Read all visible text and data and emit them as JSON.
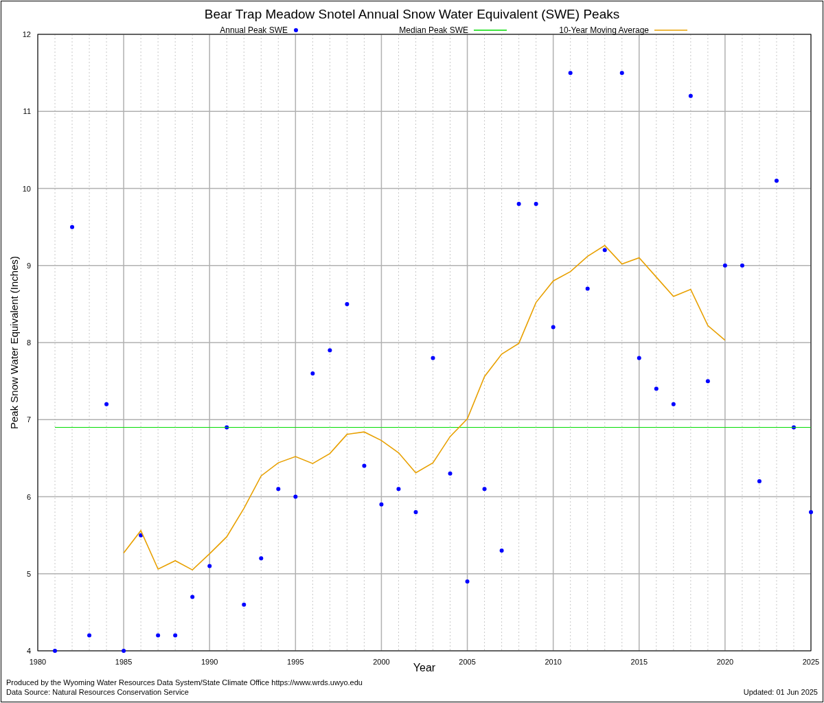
{
  "chart_data": {
    "type": "scatter",
    "title": "Bear Trap Meadow Snotel Annual Snow Water Equivalent (SWE) Peaks",
    "xlabel": "Year",
    "ylabel": "Peak Snow Water Equivalent (Inches)",
    "x": [
      1981,
      1982,
      1983,
      1984,
      1985,
      1986,
      1987,
      1988,
      1989,
      1990,
      1991,
      1992,
      1993,
      1994,
      1995,
      1996,
      1997,
      1998,
      1999,
      2000,
      2001,
      2002,
      2003,
      2004,
      2005,
      2006,
      2007,
      2008,
      2009,
      2010,
      2011,
      2012,
      2013,
      2014,
      2015,
      2016,
      2017,
      2018,
      2019,
      2020,
      2021,
      2022,
      2023,
      2024,
      2025
    ],
    "series": [
      {
        "name": "Annual Peak SWE",
        "color": "#0000ff",
        "values": [
          4.0,
          9.5,
          4.2,
          7.2,
          4.0,
          5.5,
          4.2,
          4.2,
          4.7,
          5.1,
          6.9,
          4.6,
          5.2,
          6.1,
          6.0,
          7.6,
          7.9,
          8.5,
          6.4,
          5.9,
          6.1,
          5.8,
          7.8,
          6.3,
          4.9,
          6.1,
          5.3,
          9.8,
          9.8,
          8.2,
          11.5,
          8.7,
          9.2,
          11.5,
          7.8,
          7.4,
          7.2,
          11.2,
          7.5,
          9.0,
          9.0,
          6.2,
          10.1,
          6.9,
          5.8
        ]
      },
      {
        "name": "Median Peak SWE",
        "type": "line",
        "color": "#00dd00",
        "values": [
          6.9,
          6.9,
          6.9,
          6.9,
          6.9,
          6.9,
          6.9,
          6.9,
          6.9,
          6.9,
          6.9,
          6.9,
          6.9,
          6.9,
          6.9,
          6.9,
          6.9,
          6.9,
          6.9,
          6.9,
          6.9,
          6.9,
          6.9,
          6.9,
          6.9,
          6.9,
          6.9,
          6.9,
          6.9,
          6.9,
          6.9,
          6.9,
          6.9,
          6.9,
          6.9,
          6.9,
          6.9,
          6.9,
          6.9,
          6.9,
          6.9,
          6.9,
          6.9,
          6.9,
          6.9
        ]
      },
      {
        "name": "10-Year Moving Average",
        "type": "line",
        "color": "#e8a000",
        "values": [
          null,
          null,
          null,
          null,
          5.27,
          5.56,
          5.06,
          5.17,
          5.05,
          5.26,
          5.48,
          5.85,
          6.27,
          6.44,
          6.52,
          6.43,
          6.56,
          6.81,
          6.84,
          6.73,
          6.57,
          6.31,
          6.44,
          6.78,
          7.01,
          7.56,
          7.85,
          7.99,
          8.52,
          8.8,
          8.92,
          9.12,
          9.26,
          9.02,
          9.1,
          8.85,
          8.6,
          8.69,
          8.22,
          8.03,
          null,
          null,
          null,
          null,
          null
        ]
      }
    ],
    "xlim": [
      1980,
      2025
    ],
    "ylim": [
      4,
      12
    ],
    "xticks": [
      1980,
      1985,
      1990,
      1995,
      2000,
      2005,
      2010,
      2015,
      2020,
      2025
    ],
    "yticks": [
      4,
      5,
      6,
      7,
      8,
      9,
      10,
      11,
      12
    ],
    "grid": true,
    "legend": true
  },
  "footer": {
    "credit": "Produced by the Wyoming Water Resources Data System/State Climate Office https://www.wrds.uwyo.edu",
    "source": "Data Source: Natural Resources Conservation Service",
    "updated": "Updated: 01 Jun 2025"
  }
}
